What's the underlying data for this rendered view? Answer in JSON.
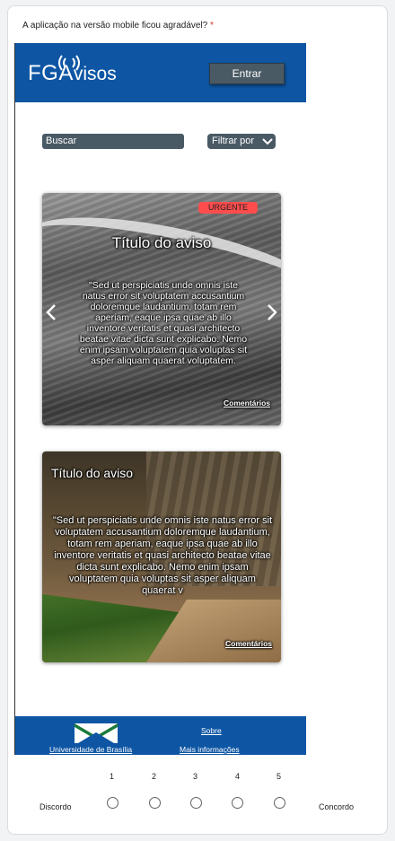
{
  "question": {
    "text": "A aplicação na versão mobile ficou agradável?",
    "required_mark": "*"
  },
  "mockup": {
    "header": {
      "logo_main": "FGA",
      "logo_suffix": "visos",
      "login_button": "Entrar"
    },
    "search": {
      "placeholder": "Buscar",
      "filter_label": "Filtrar por"
    },
    "notices": [
      {
        "badge": "URGENTE",
        "title": "Título do aviso",
        "body": "\"Sed ut perspiciatis unde omnis iste natus error sit voluptatem accusantium doloremque laudantium, totam rem aperiam, eaque ipsa quae ab illo inventore veritatis et quasi architecto beatae vitae dicta sunt explicabo. Nemo enim ipsam voluptatem quia voluptas sit asper aliquam quaerat voluptatem.",
        "comments_link": "Comentários"
      },
      {
        "title": "Título do aviso",
        "body": "\"Sed ut perspiciatis unde omnis iste natus error sit voluptatem accusantium doloremque laudantium, totam rem aperiam, eaque ipsa quae ab illo inventore veritatis et quasi architecto beatae vitae dicta sunt explicabo. Nemo enim ipsam voluptatem quia voluptas sit asper aliquam quaerat v",
        "comments_link": "Comentários"
      }
    ],
    "footer": {
      "university_link": "Universidade de Brasília",
      "about_link": "Sobre",
      "more_info_link": "Mais informações"
    },
    "colors": {
      "brand_blue": "#0e56a4",
      "control_gray": "#4a5a65",
      "urgent_red": "#ff4d4d"
    }
  },
  "scale": {
    "options": [
      "1",
      "2",
      "3",
      "4",
      "5"
    ],
    "low_label": "Discordo",
    "high_label": "Concordo",
    "selected": null
  }
}
